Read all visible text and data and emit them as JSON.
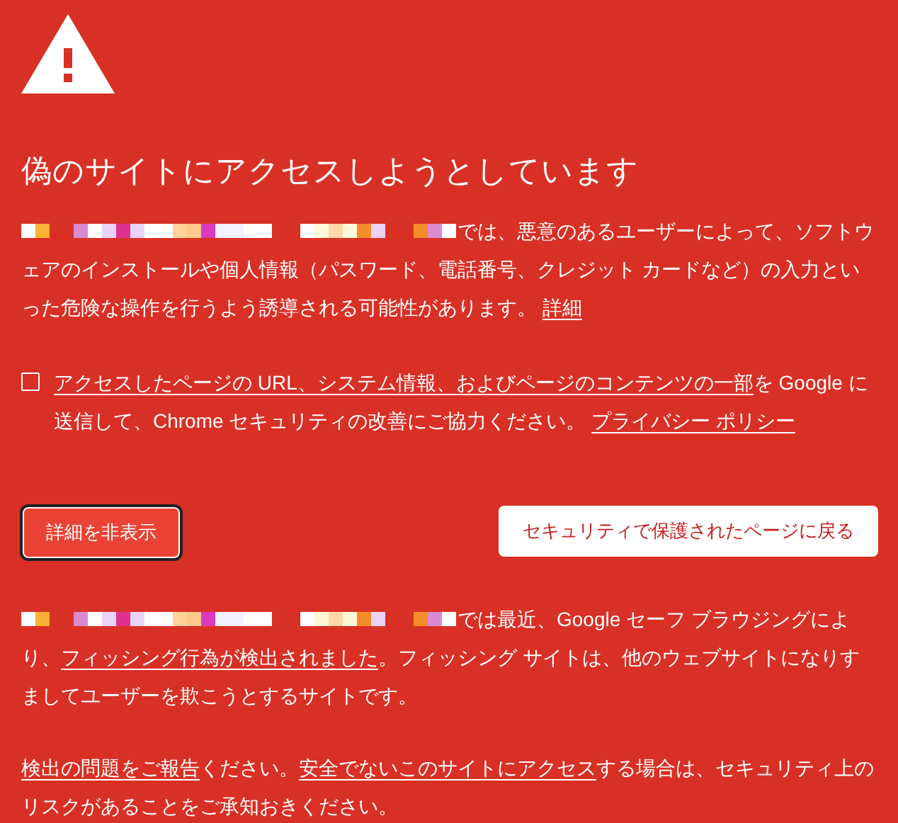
{
  "title": "偽のサイトにアクセスしようとしています",
  "main_paragraph": {
    "segments": [
      {
        "kind": "redacted"
      },
      {
        "kind": "text",
        "text": "では、悪意のあるユーザーによって、ソフトウェアのインストールや個人情報（パスワード、電話番号、クレジット カードなど）の入力といった危険な操作を行うよう誘導される可能性があります。 "
      },
      {
        "kind": "link",
        "text": "詳細"
      }
    ]
  },
  "report_option": {
    "checked": false,
    "segments": [
      {
        "kind": "link",
        "text": "アクセスしたページの URL、システム情報、およびページのコンテンツの一部"
      },
      {
        "kind": "text",
        "text": "を Google に送信して、Chrome セキュリティの改善にご協力ください。 "
      },
      {
        "kind": "link",
        "text": "プライバシー ポリシー"
      }
    ]
  },
  "buttons": [
    {
      "label": "詳細を非表示",
      "kind": "primary",
      "focused": true
    },
    {
      "label": "セキュリティで保護されたページに戻る",
      "kind": "secondary",
      "focused": false
    }
  ],
  "details": [
    {
      "segments": [
        {
          "kind": "redacted"
        },
        {
          "kind": "text",
          "text": "では最近、Google セーフ ブラウジングにより、"
        },
        {
          "kind": "link",
          "text": "フィッシング行為が検出されました"
        },
        {
          "kind": "text",
          "text": "。フィッシング サイトは、他のウェブサイトになりすましてユーザーを欺こうとするサイトです。"
        }
      ]
    },
    {
      "segments": [
        {
          "kind": "link",
          "text": "検出の問題をご報告"
        },
        {
          "kind": "text",
          "text": "ください。"
        },
        {
          "kind": "link",
          "text": "安全でないこのサイトにアクセス"
        },
        {
          "kind": "text",
          "text": "する場合は、セキュリティ上のリスクがあることをご承知おきください。"
        }
      ]
    }
  ]
}
